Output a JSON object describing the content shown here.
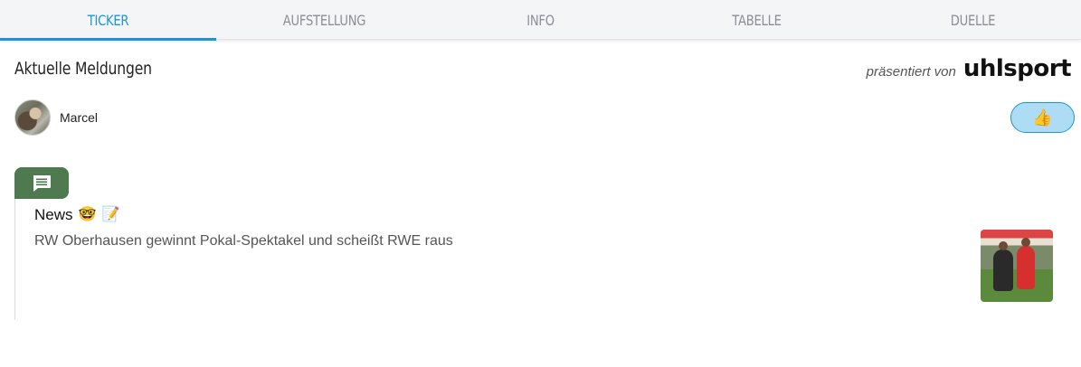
{
  "tabs": [
    {
      "label": "TICKER",
      "active": true
    },
    {
      "label": "AUFSTELLUNG",
      "active": false
    },
    {
      "label": "INFO",
      "active": false
    },
    {
      "label": "TABELLE",
      "active": false
    },
    {
      "label": "DUELLE",
      "active": false
    }
  ],
  "section": {
    "title": "Aktuelle Meldungen",
    "sponsor_prefix": "präsentiert von",
    "sponsor_logo": "uhlsport"
  },
  "author": {
    "name": "Marcel",
    "avatar_icon": "user-photo"
  },
  "like_button": {
    "icon": "thumbs-up-icon",
    "glyph": "👍"
  },
  "entry": {
    "type_icon": "comment-icon",
    "category": "News",
    "emojis": [
      "🤓",
      "📝"
    ],
    "text": "RW Oberhausen gewinnt Pokal-Spektakel und scheißt RWE raus",
    "image_alt": "football-match-photo"
  },
  "colors": {
    "accent": "#1a96d4",
    "entry_tab": "#4f7a4f",
    "like_bg": "#aedcf5"
  }
}
